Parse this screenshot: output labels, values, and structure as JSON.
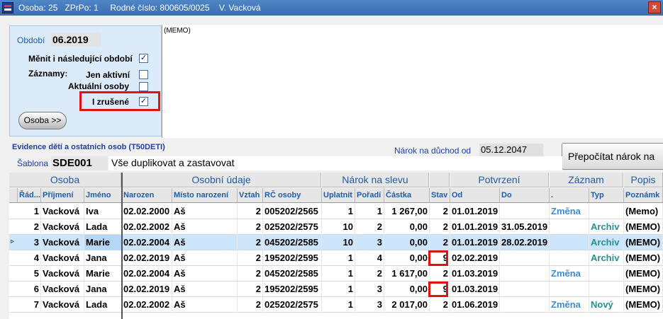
{
  "titlebar": {
    "title": "Osoba: 25   ZPrPo: 1     Rodné číslo: 800605/0025    V. Vacková",
    "close": "×"
  },
  "left_panel": {
    "obdobi_label": "Období",
    "obdobi_value": "06.2019",
    "menit_label": "Měnit i následující období",
    "menit_checked": "✓",
    "zaznamy_label": "Záznamy:",
    "jen_aktivni_label": "Jen aktivní",
    "aktualni_osoby_label": "Aktuální osoby",
    "i_zrusene_label": "I zrušené",
    "i_zrusene_checked": "✓",
    "osoba_button": "Osoba >>"
  },
  "memo": {
    "text": "(MEMO)"
  },
  "evidence": {
    "title": "Evidence dětí a ostatních osob   (T50DETI)",
    "narok_label": "Nárok na důchod od",
    "narok_value": "05.12.2047",
    "prepocitat_button": "Přepočítat nárok na",
    "sablona_label": "Šablona",
    "sablona_code": "SDE001",
    "sablona_desc": "Vše duplikovat a zastavovat"
  },
  "grid": {
    "group_headers": [
      "Osoba",
      "Osobní údaje",
      "Nárok na slevu",
      "Potvrzení",
      "Záznam",
      "Popis"
    ],
    "columns": [
      "Řád...",
      "Příjmení",
      "Jméno",
      "Narozen",
      "Místo narození",
      "Vztah",
      "RČ osoby",
      "Uplatnit",
      "Pořadí",
      "Částka",
      "Stav",
      "Od",
      "Do",
      ".",
      "Typ",
      "Poznámk"
    ],
    "rows": [
      {
        "rad": "1",
        "prijmeni": "Vacková",
        "jmeno": "Iva",
        "narozen": "02.02.2000",
        "misto": "Aš",
        "vztah": "2",
        "rc": "005202/2565",
        "uplatnit": "1",
        "poradi": "1",
        "castka": "1 267,00",
        "stav": "2",
        "od": "01.01.2019",
        "do": "",
        "zaznam": "Změna",
        "typ": "",
        "poznamka": "(Memo)"
      },
      {
        "rad": "2",
        "prijmeni": "Vacková",
        "jmeno": "Lada",
        "narozen": "02.02.2002",
        "misto": "Aš",
        "vztah": "2",
        "rc": "025202/2575",
        "uplatnit": "10",
        "poradi": "2",
        "castka": "0,00",
        "stav": "2",
        "od": "01.01.2019",
        "do": "31.05.2019",
        "zaznam": "",
        "typ": "Archiv",
        "poznamka": "(MEMO)"
      },
      {
        "rad": "3",
        "prijmeni": "Vacková",
        "jmeno": "Marie",
        "narozen": "02.02.2004",
        "misto": "Aš",
        "vztah": "2",
        "rc": "045202/2585",
        "uplatnit": "10",
        "poradi": "3",
        "castka": "0,00",
        "stav": "2",
        "od": "01.01.2019",
        "do": "28.02.2019",
        "zaznam": "",
        "typ": "Archiv",
        "poznamka": "(MEMO)"
      },
      {
        "rad": "4",
        "prijmeni": "Vacková",
        "jmeno": "Jana",
        "narozen": "02.02.2019",
        "misto": "Aš",
        "vztah": "2",
        "rc": "195202/2595",
        "uplatnit": "1",
        "poradi": "4",
        "castka": "0,00",
        "stav": "9",
        "od": "02.02.2019",
        "do": "",
        "zaznam": "",
        "typ": "Archiv",
        "poznamka": "(MEMO)"
      },
      {
        "rad": "5",
        "prijmeni": "Vacková",
        "jmeno": "Marie",
        "narozen": "02.02.2004",
        "misto": "Aš",
        "vztah": "2",
        "rc": "045202/2585",
        "uplatnit": "1",
        "poradi": "2",
        "castka": "1 617,00",
        "stav": "2",
        "od": "01.03.2019",
        "do": "",
        "zaznam": "Změna",
        "typ": "",
        "poznamka": "(MEMO)"
      },
      {
        "rad": "6",
        "prijmeni": "Vacková",
        "jmeno": "Jana",
        "narozen": "02.02.2019",
        "misto": "Aš",
        "vztah": "2",
        "rc": "195202/2595",
        "uplatnit": "1",
        "poradi": "3",
        "castka": "0,00",
        "stav": "9",
        "od": "01.03.2019",
        "do": "",
        "zaznam": "",
        "typ": "",
        "poznamka": "(MEMO)"
      },
      {
        "rad": "7",
        "prijmeni": "Vacková",
        "jmeno": "Lada",
        "narozen": "02.02.2002",
        "misto": "Aš",
        "vztah": "2",
        "rc": "025202/2575",
        "uplatnit": "1",
        "poradi": "3",
        "castka": "2 017,00",
        "stav": "2",
        "od": "01.06.2019",
        "do": "",
        "zaznam": "Změna",
        "typ": "Nový",
        "poznamka": "(MEMO)"
      }
    ],
    "selected_row_marker": "▹"
  },
  "colors": {
    "title_bar": "#3a6fb0",
    "accent_blue": "#1f5ca8",
    "highlight_red": "#e01313",
    "selected_row": "#cce5fb",
    "zmena": "#3b8ed0",
    "archiv": "#2a8e8e"
  }
}
